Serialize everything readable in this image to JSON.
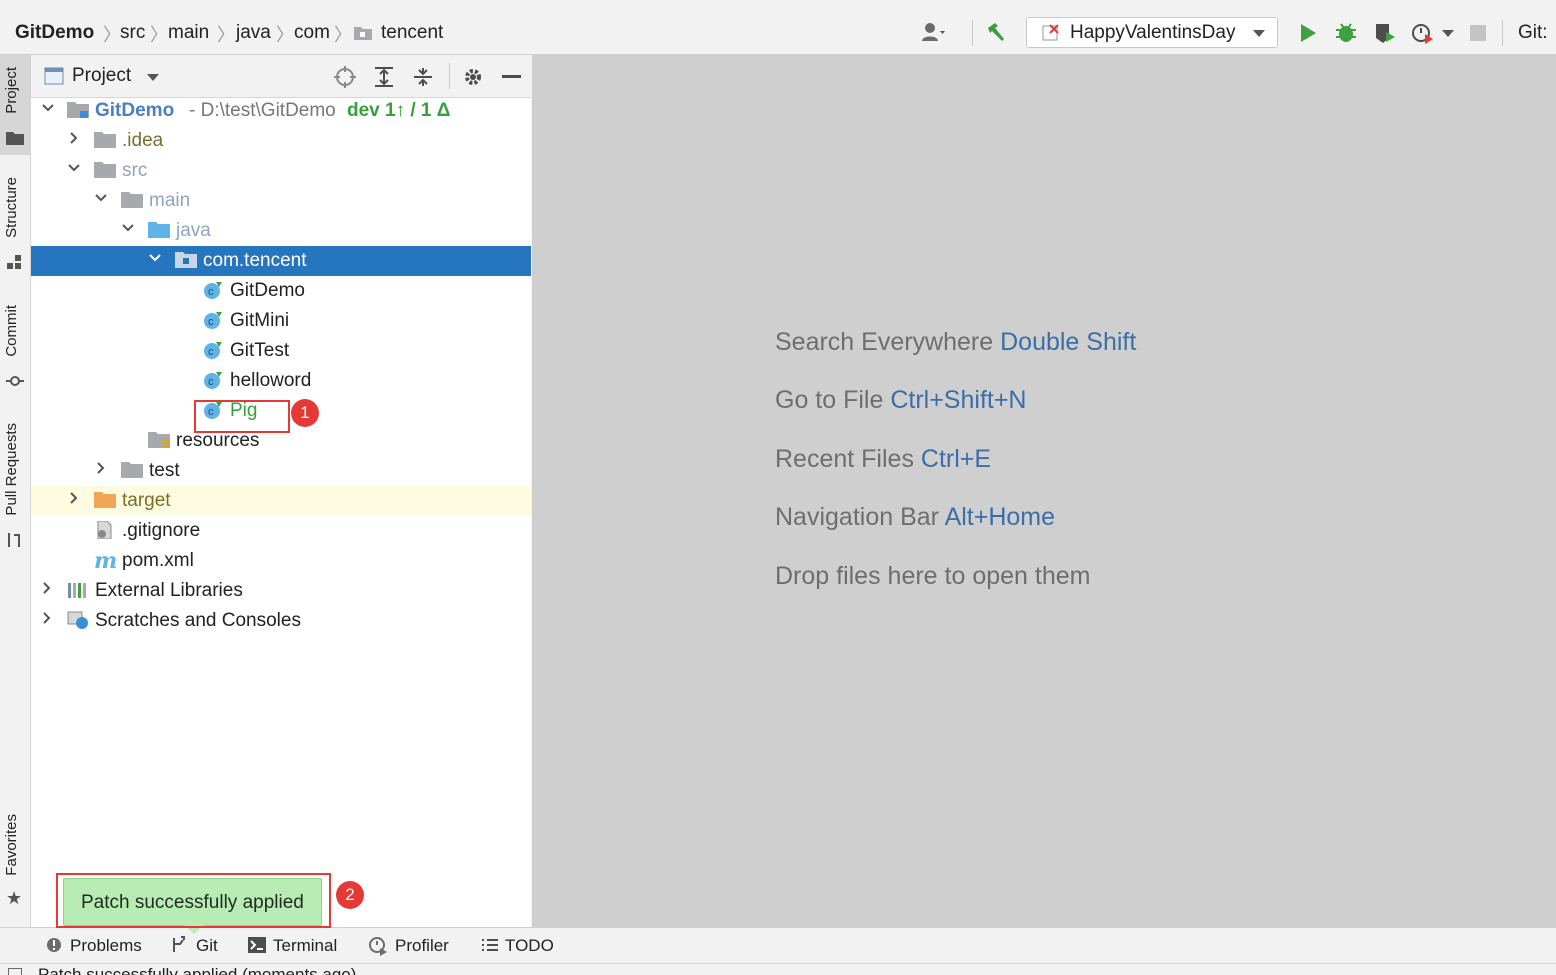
{
  "breadcrumb": {
    "items": [
      "GitDemo",
      "src",
      "main",
      "java",
      "com",
      "tencent"
    ]
  },
  "toolbar": {
    "run_config": "HappyValentinsDay",
    "git_label": "Git:"
  },
  "left_strip": {
    "tabs": [
      "Project",
      "Structure",
      "Commit",
      "Pull Requests",
      "Favorites"
    ]
  },
  "project_panel": {
    "title": "Project",
    "root": {
      "name": "GitDemo",
      "path": "- D:\\test\\GitDemo",
      "branch": "dev 1↑ / 1 Δ"
    },
    "tree": [
      {
        "label": ".idea"
      },
      {
        "label": "src"
      },
      {
        "label": "main"
      },
      {
        "label": "java"
      },
      {
        "label": "com.tencent"
      },
      {
        "label": "GitDemo"
      },
      {
        "label": "GitMini"
      },
      {
        "label": "GitTest"
      },
      {
        "label": "helloword"
      },
      {
        "label": "Pig"
      },
      {
        "label": "resources"
      },
      {
        "label": "test"
      },
      {
        "label": "target"
      },
      {
        "label": ".gitignore"
      },
      {
        "label": "pom.xml"
      },
      {
        "label": "External Libraries"
      },
      {
        "label": "Scratches and Consoles"
      }
    ]
  },
  "editor_hints": [
    {
      "text": "Search Everywhere",
      "key": "Double Shift"
    },
    {
      "text": "Go to File",
      "key": "Ctrl+Shift+N"
    },
    {
      "text": "Recent Files",
      "key": "Ctrl+E"
    },
    {
      "text": "Navigation Bar",
      "key": "Alt+Home"
    },
    {
      "text": "Drop files here to open them",
      "key": ""
    }
  ],
  "bottom_tabs": [
    "Problems",
    "Git",
    "Terminal",
    "Profiler",
    "TODO"
  ],
  "toast": "Patch successfully applied",
  "status": "Patch successfully applied (moments ago)",
  "annotations": [
    "1",
    "2"
  ],
  "colors": {
    "selection": "#2675bf",
    "new_file_green": "#36a13a",
    "editor_bg": "#cfcfcf",
    "toast_bg": "#b8ecb4",
    "annotation_red": "#e53935",
    "link_blue": "#3b6ea8"
  }
}
